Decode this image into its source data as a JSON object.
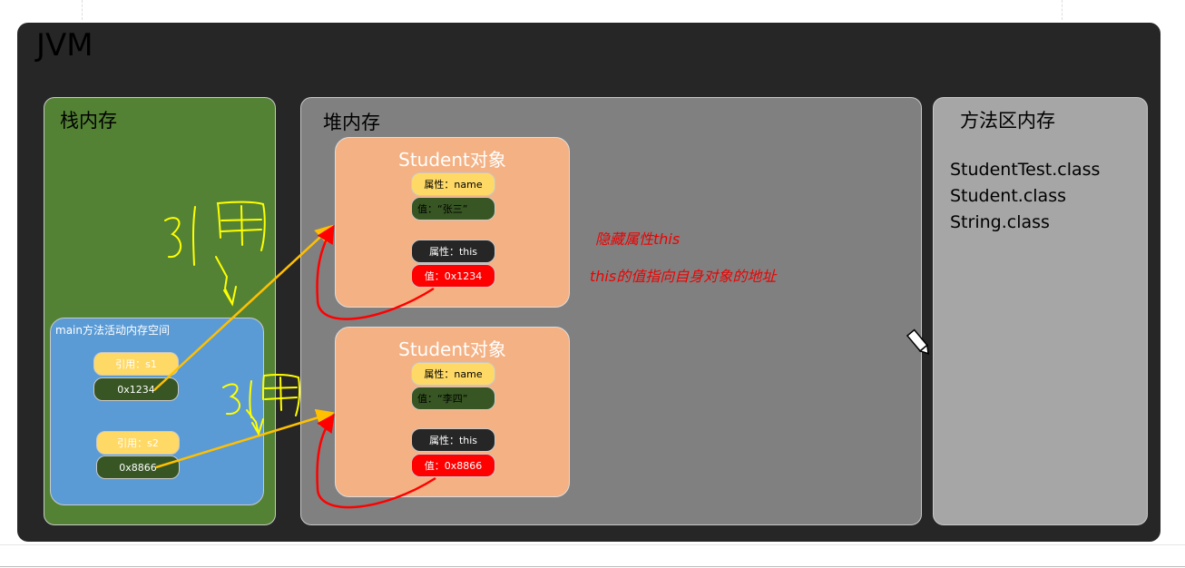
{
  "jvm_title": "JVM",
  "stack": {
    "title": "栈内存",
    "frame_title": "main方法活动内存空间",
    "refs": [
      {
        "label": "引用：s1",
        "value": "0x1234"
      },
      {
        "label": "引用：s2",
        "value": "0x8866"
      }
    ]
  },
  "heap": {
    "title": "堆内存",
    "objects": [
      {
        "title": "Student对象",
        "name_label": "属性：name",
        "name_value": "值：“张三”",
        "this_label": "属性：this",
        "this_value": "值：0x1234"
      },
      {
        "title": "Student对象",
        "name_label": "属性：name",
        "name_value": "值：“李四”",
        "this_label": "属性：this",
        "this_value": "值：0x8866"
      }
    ],
    "notes": [
      "隐藏属性this",
      "this的值指向自身对象的地址"
    ]
  },
  "method_area": {
    "title": "方法区内存",
    "classes": [
      "StudentTest.class",
      "Student.class",
      "String.class"
    ]
  },
  "annotations": {
    "handwritten": [
      "引用",
      "引用"
    ]
  },
  "colors": {
    "jvm": "#262626",
    "stack": "#548235",
    "heap": "#808080",
    "method": "#a6a6a6",
    "frame": "#5b9bd5",
    "object": "#f4b183",
    "ref_label": "#ffd966",
    "ref_value": "#375623",
    "this_value": "#ff0000",
    "arrow": "#ffc000",
    "ink": "#ffff00"
  }
}
